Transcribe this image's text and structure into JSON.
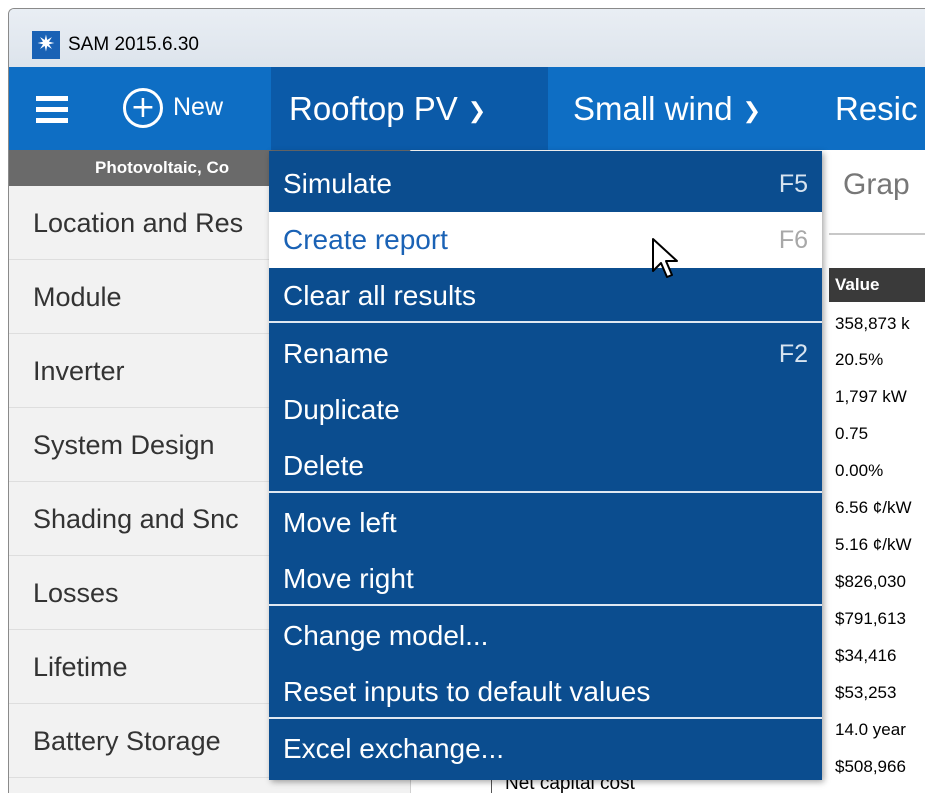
{
  "window": {
    "title": "SAM 2015.6.30"
  },
  "navbar": {
    "new_label": "New",
    "tabs": [
      {
        "label": "Rooftop PV",
        "active": true
      },
      {
        "label": "Small wind",
        "active": false
      },
      {
        "label": "Resic",
        "active": false
      }
    ]
  },
  "sidebar": {
    "header": "Photovoltaic, Co",
    "items": [
      {
        "label": "Location and Res"
      },
      {
        "label": "Module"
      },
      {
        "label": "Inverter"
      },
      {
        "label": "System Design"
      },
      {
        "label": "Shading and Snc"
      },
      {
        "label": "Losses"
      },
      {
        "label": "Lifetime"
      },
      {
        "label": "Battery Storage"
      }
    ]
  },
  "content": {
    "graph_heading": "Grap",
    "value_header": "Value",
    "values": [
      "358,873 k",
      "20.5%",
      "1,797 kW",
      "0.75",
      "0.00%",
      "6.56 ¢/kW",
      "5.16 ¢/kW",
      "$826,030",
      "$791,613",
      "$34,416",
      "$53,253",
      "14.0 year",
      "$508,966"
    ],
    "partial_metric_label": "Net capital cost"
  },
  "menu": {
    "items": [
      {
        "label": "Simulate",
        "shortcut": "F5"
      },
      {
        "label": "Create report",
        "shortcut": "F6",
        "hovered": true
      },
      {
        "label": "Clear all results",
        "shortcut": ""
      },
      {
        "label": "Rename",
        "shortcut": "F2"
      },
      {
        "label": "Duplicate",
        "shortcut": ""
      },
      {
        "label": "Delete",
        "shortcut": ""
      },
      {
        "label": "Move left",
        "shortcut": ""
      },
      {
        "label": "Move right",
        "shortcut": ""
      },
      {
        "label": "Change model...",
        "shortcut": ""
      },
      {
        "label": "Reset inputs to default values",
        "shortcut": ""
      },
      {
        "label": "Excel exchange...",
        "shortcut": ""
      }
    ]
  },
  "icons": {
    "app": "sun-icon",
    "menu": "hamburger-icon",
    "new": "plus-circle-icon",
    "tab_dropdown": "chevron-down-icon",
    "pointer": "mouse-cursor-icon"
  },
  "colors": {
    "navbar": "#0e6ec4",
    "active_tab": "#0b5aa8",
    "menu_bg": "#0b4d8f",
    "hover_text": "#1a62b5",
    "sidebar_header": "#6a6a6a"
  }
}
